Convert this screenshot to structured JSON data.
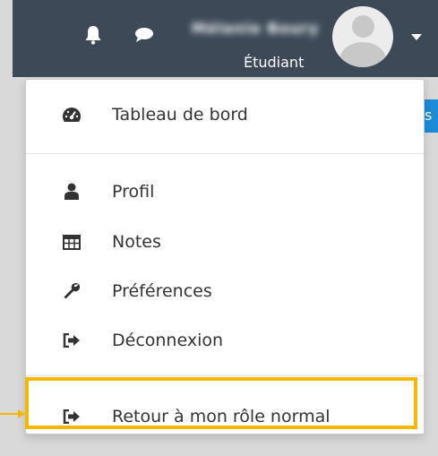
{
  "navbar": {
    "username": "Mélanie Boury",
    "role": "Étudiant",
    "icons": {
      "notifications": "bell-icon",
      "messages": "chat-bubble-icon",
      "user_menu": "chevron-down-icon"
    }
  },
  "background_tab_fragment": "s",
  "menu": {
    "items": [
      {
        "label": "Tableau de bord",
        "icon": "dashboard-gauge-icon"
      },
      {
        "label": "Profil",
        "icon": "user-icon"
      },
      {
        "label": "Notes",
        "icon": "table-grid-icon"
      },
      {
        "label": "Préférences",
        "icon": "wrench-icon"
      },
      {
        "label": "Déconnexion",
        "icon": "sign-out-icon"
      },
      {
        "label": "Retour à mon rôle normal",
        "icon": "sign-out-icon"
      }
    ]
  },
  "colors": {
    "navbar": "#3d4957",
    "highlight": "#f5b800",
    "accent_blue": "#1c8bd8",
    "menu_text": "#333333"
  }
}
